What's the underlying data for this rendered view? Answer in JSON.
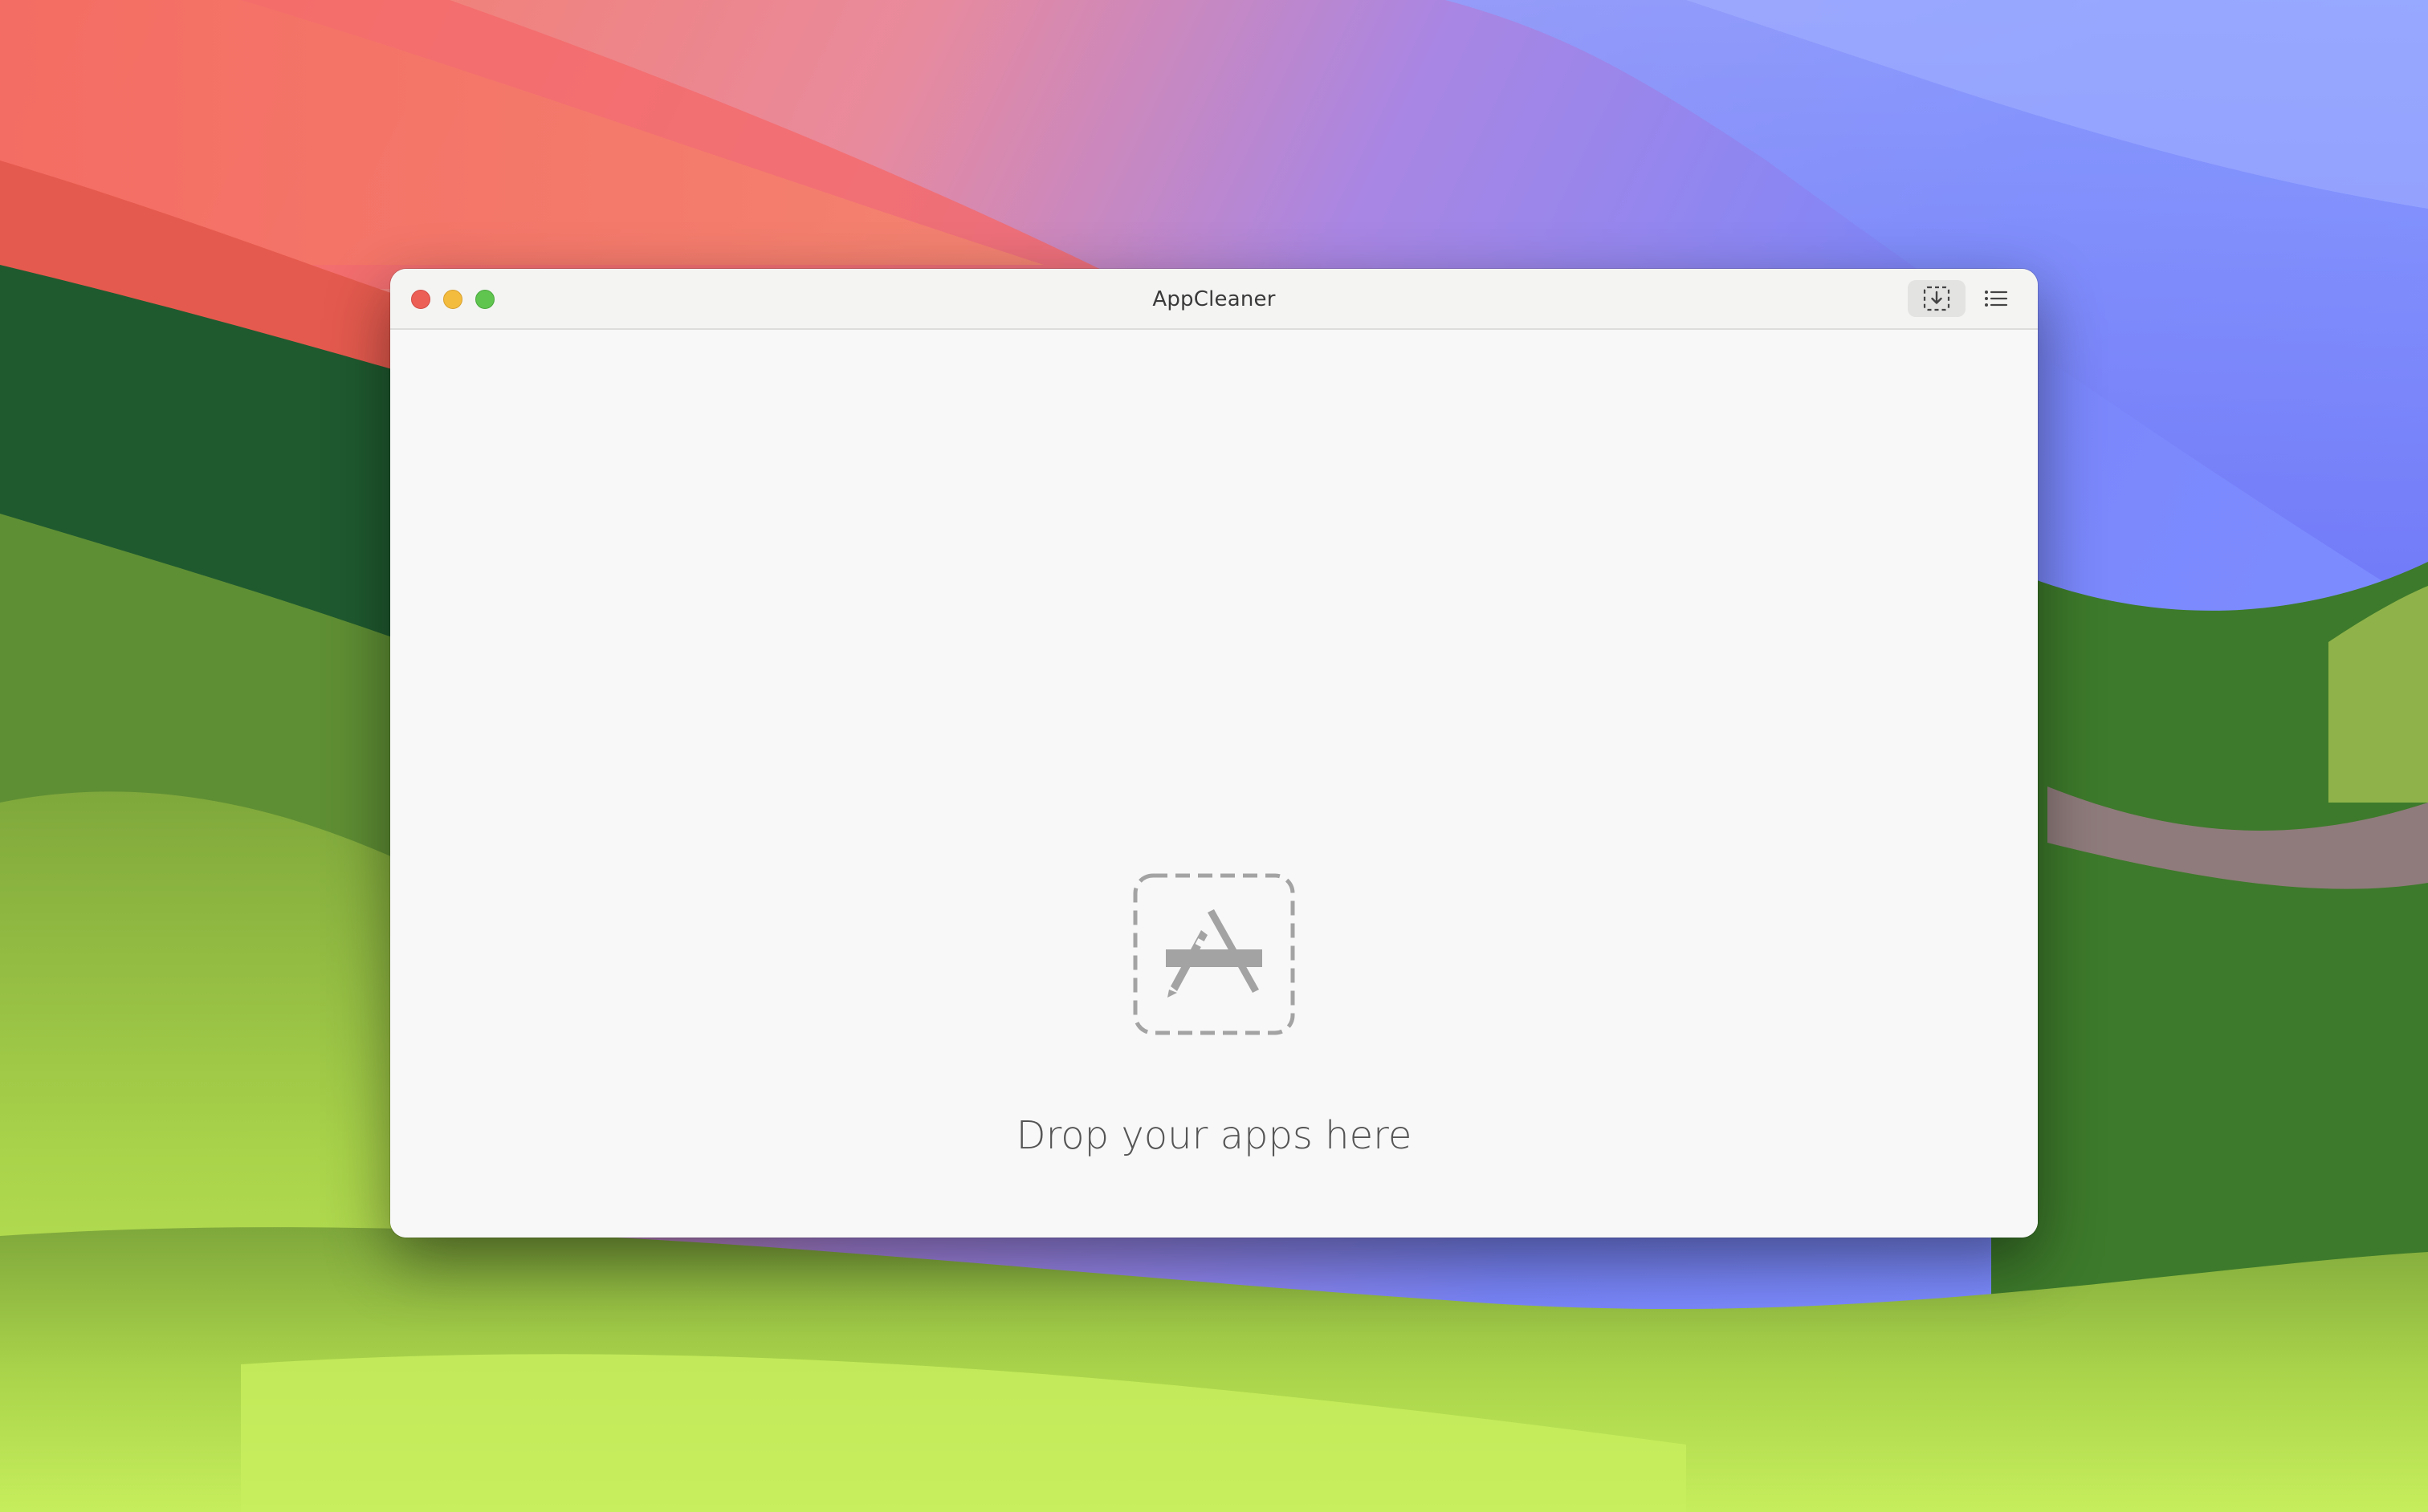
{
  "window": {
    "title": "AppCleaner"
  },
  "toolbar": {
    "buttons": [
      {
        "icon": "drop-zone-icon",
        "active": true
      },
      {
        "icon": "list-icon",
        "active": false
      }
    ]
  },
  "main": {
    "drop_prompt": "Drop your apps here",
    "drop_icon": "app-store-icon"
  },
  "colors": {
    "close": "#ec5f57",
    "minimize": "#f3bc3f",
    "zoom": "#5fc54f",
    "window_bg": "#f8f8f8",
    "icon_gray": "#a3a3a3"
  }
}
